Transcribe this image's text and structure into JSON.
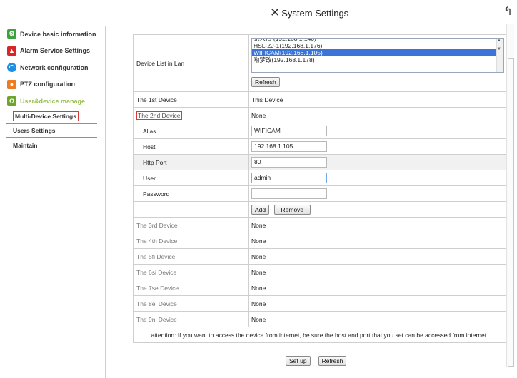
{
  "header": {
    "title": "System Settings",
    "title_icon": "tools-icon",
    "back_icon": "back-arrow-icon"
  },
  "sidebar": {
    "items": [
      {
        "label": "Device basic information",
        "icon": "gear-icon"
      },
      {
        "label": "Alarm Service Settings",
        "icon": "bell-icon"
      },
      {
        "label": "Network configuration",
        "icon": "wifi-icon"
      },
      {
        "label": "PTZ configuration",
        "icon": "camera-icon"
      },
      {
        "label": "User&device manage",
        "icon": "user-icon"
      }
    ],
    "submenu": [
      "Multi-Device Settings",
      "Users Settings",
      "Maintain"
    ]
  },
  "lan": {
    "label": "Device List in Lan",
    "options": [
      "HSL-ZJ-1(192.168.1.176)",
      "WIFICAM(192.168.1.105)",
      "吻梦改(192.168.1.178)"
    ],
    "selected": "WIFICAM(192.168.1.105)",
    "refresh": "Refresh"
  },
  "devices": {
    "first": {
      "label": "The 1st Device",
      "value": "This Device"
    },
    "second": {
      "label": "The 2nd Device",
      "value": "None"
    },
    "others": [
      {
        "label": "The 3rd Device",
        "value": "None"
      },
      {
        "label": "The 4th Device",
        "value": "None"
      },
      {
        "label": "The 5fi Device",
        "value": "None"
      },
      {
        "label": "The 6si Device",
        "value": "None"
      },
      {
        "label": "The 7se Device",
        "value": "None"
      },
      {
        "label": "The 8ei Device",
        "value": "None"
      },
      {
        "label": "The 9ni Device",
        "value": "None"
      }
    ]
  },
  "form": {
    "alias": {
      "label": "Alias",
      "value": "WIFICAM"
    },
    "host": {
      "label": "Host",
      "value": "192.168.1.105"
    },
    "port": {
      "label": "Http Port",
      "value": "80"
    },
    "user": {
      "label": "User",
      "value": "admin"
    },
    "password": {
      "label": "Password",
      "value": ""
    },
    "add": "Add",
    "remove": "Remove"
  },
  "attention": "attention: If you want to access the device from internet, be sure the host and port that you set can be accessed from internet.",
  "footer": {
    "setup": "Set up",
    "refresh": "Refresh"
  },
  "colors": {
    "accent_green": "#7cab3a",
    "selection_blue": "#3a74d8",
    "highlight_red": "#d83a3a"
  }
}
